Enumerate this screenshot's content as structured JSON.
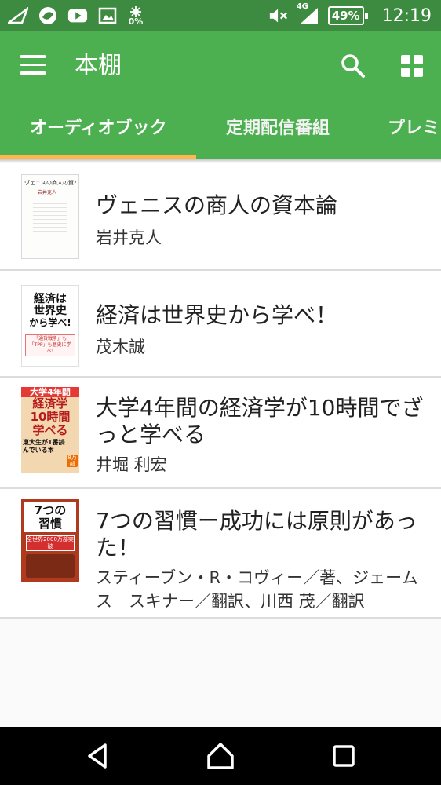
{
  "status_bar": {
    "battery": "49%",
    "time": "12:19",
    "network": "4G",
    "data_usage": "0%",
    "icons": [
      "send-icon",
      "app-logo-icon",
      "youtube-icon",
      "image-icon",
      "data-saver-icon",
      "mute-icon",
      "signal-icon",
      "battery-icon"
    ]
  },
  "toolbar": {
    "title": "本棚",
    "background_color": "#4caf50",
    "icons": [
      "menu-icon",
      "search-icon",
      "grid-view-icon"
    ]
  },
  "tabs": [
    {
      "label": "オーディオブック",
      "selected": true
    },
    {
      "label": "定期配信番組",
      "selected": false
    },
    {
      "label": "プレミア",
      "selected": false
    }
  ],
  "tab_indicator_color": "#ffb74d",
  "books": [
    {
      "title": "ヴェニスの商人の資本論",
      "author": "岩井克人",
      "cover": {
        "title": "ヴェニスの商人の資本論",
        "author": "岩井克人"
      }
    },
    {
      "title": "経済は世界史から学べ！",
      "author": "茂木誠",
      "cover": {
        "line1": "経済は",
        "line2": "世界史",
        "line3": "から学べ!",
        "band": "「通貨戦争」も「TPP」も歴史に学べ!"
      }
    },
    {
      "title": "大学4年間の経済学が10時間でざっと学べる",
      "author": "井堀 利宏",
      "cover": {
        "top": "大学4年間",
        "line1": "経済学",
        "line2": "10時間",
        "line3": "学べる",
        "tag": "東大生が1番読んでいる本",
        "badge": "8万部"
      }
    },
    {
      "title": "7つの習慣ー成功には原則があった！",
      "author": "スティーブン・R・コヴィー／著、ジェームス　スキナー／翻訳、川西 茂／翻訳",
      "cover": {
        "line1": "7つの",
        "line2": "習慣",
        "badge": "全世界2000万部突破"
      }
    }
  ],
  "nav_bar": {
    "icons": [
      "back-icon",
      "home-icon",
      "recents-icon"
    ]
  }
}
